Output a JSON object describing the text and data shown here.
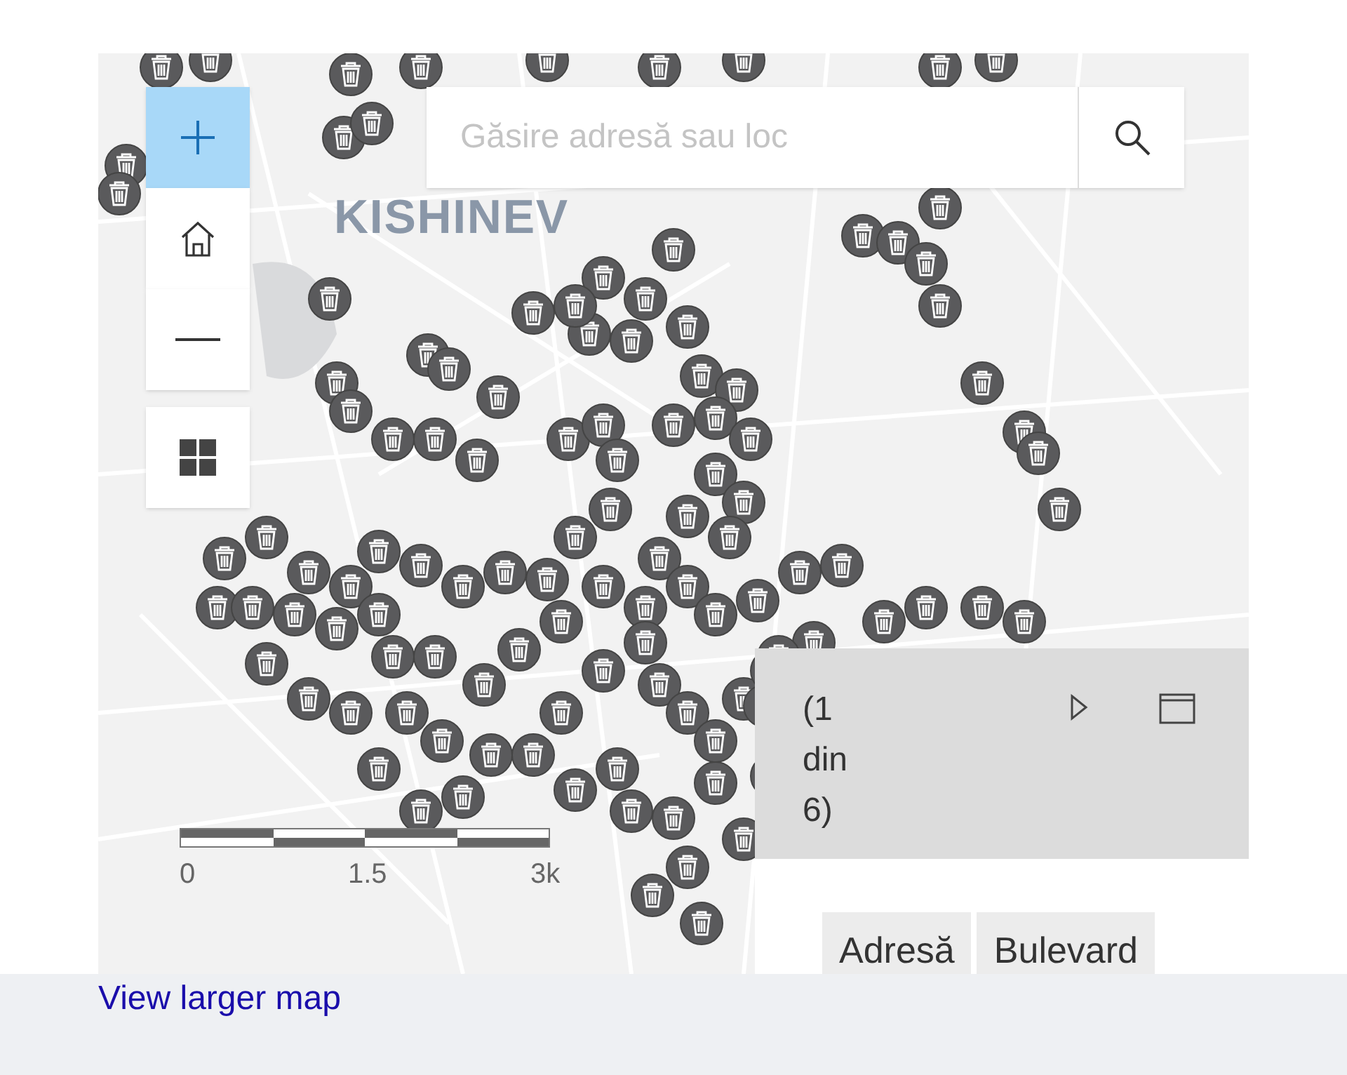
{
  "map": {
    "city_label": "KISHINEV",
    "controls": [
      {
        "kind": "zoom_in",
        "highlighted": true
      },
      {
        "kind": "home",
        "highlighted": false
      },
      {
        "kind": "zoom_out",
        "highlighted": false
      },
      {
        "kind": "basemap",
        "highlighted": false
      }
    ],
    "search": {
      "placeholder": "Găsire adresă sau loc"
    },
    "scale_bar": {
      "labels": [
        "0",
        "1.5",
        "3k"
      ]
    },
    "popup": {
      "counter": "(1 din 6)",
      "columns": [
        "Adresă",
        "Bulevard"
      ]
    }
  },
  "footer": {
    "link": "View larger map"
  }
}
